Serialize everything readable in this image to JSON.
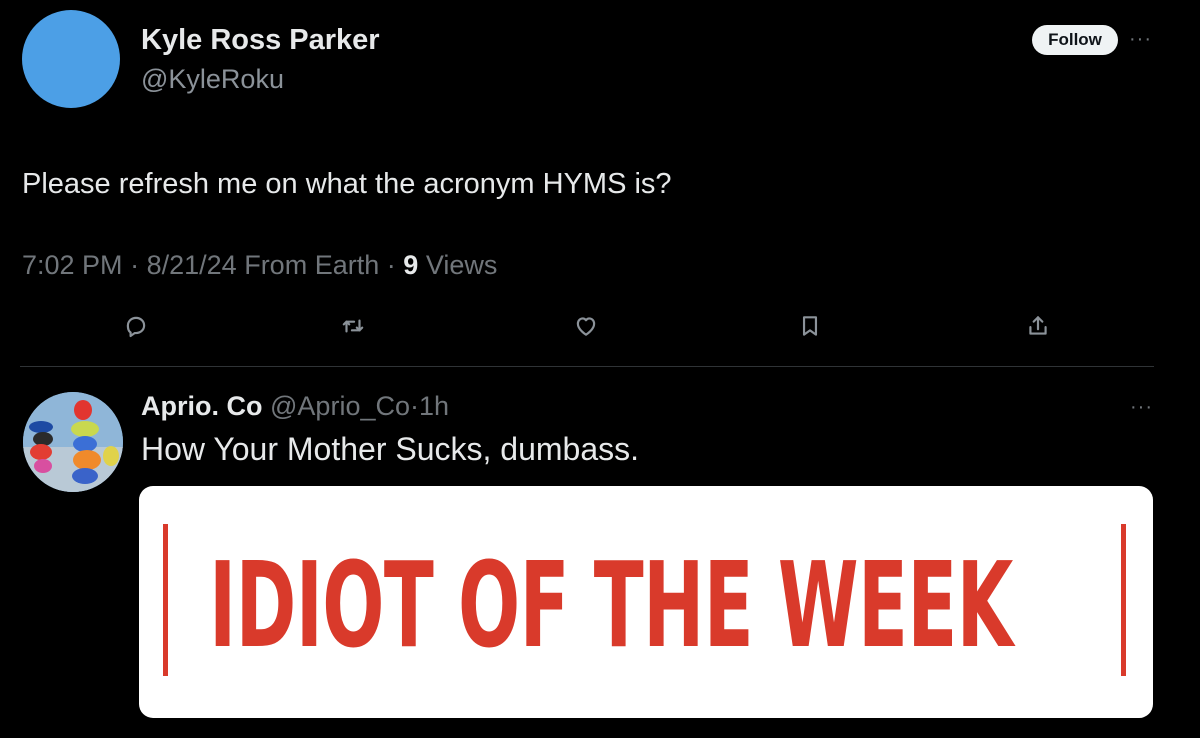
{
  "tweet": {
    "author_name": "Kyle Ross Parker",
    "author_handle": "@KyleRoku",
    "follow_label": "Follow",
    "more_label": "···",
    "text": "Please refresh me on what the acronym HYMS is?",
    "time": "7:02 PM",
    "date": "8/21/24",
    "location": "From Earth",
    "views_count": "9",
    "views_label": "Views",
    "actions": [
      "reply-icon",
      "retweet-icon",
      "like-icon",
      "bookmark-icon",
      "share-icon"
    ]
  },
  "reply": {
    "author_name": "Aprio. Co",
    "author_handle": "@Aprio_Co",
    "age": "1h",
    "more_label": "···",
    "text": "How Your Mother Sucks, dumbass.",
    "image_headline": "IDIOT OF THE WEEK"
  },
  "colors": {
    "background": "#000000",
    "text": "#e7e9ea",
    "muted": "#71767b",
    "accent_red": "#d93a2b",
    "avatar_blue": "#4c9fe6"
  }
}
